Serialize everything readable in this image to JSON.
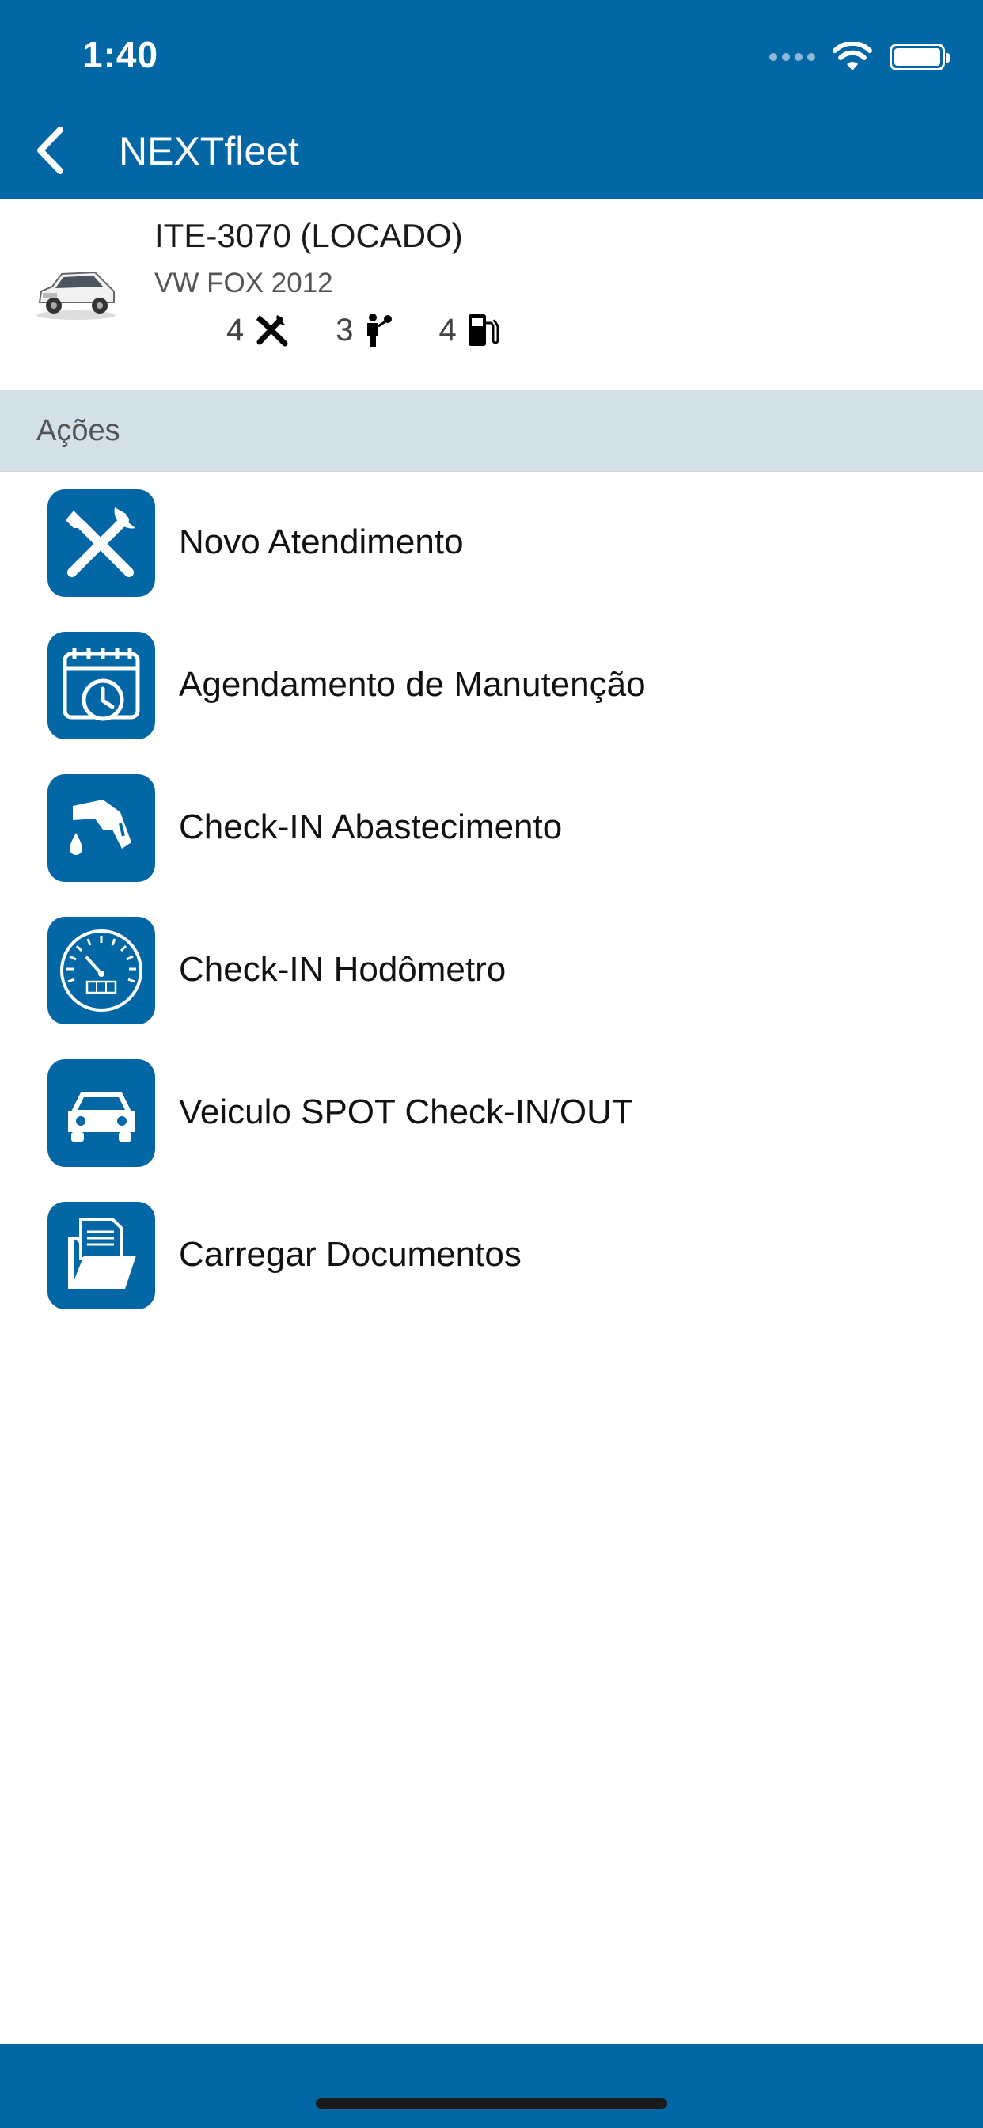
{
  "status_bar": {
    "time": "1:40"
  },
  "nav": {
    "title": "NEXTfleet"
  },
  "vehicle": {
    "plate": "ITE-3070 (LOCADO)",
    "model": "VW FOX 2012",
    "stats": [
      {
        "value": "4",
        "icon": "tools-icon"
      },
      {
        "value": "3",
        "icon": "attendant-icon"
      },
      {
        "value": "4",
        "icon": "fuel-pump-icon"
      }
    ]
  },
  "section": {
    "title": "Ações"
  },
  "actions": [
    {
      "label": "Novo Atendimento",
      "icon": "tools-icon"
    },
    {
      "label": "Agendamento de Manutenção",
      "icon": "calendar-clock-icon"
    },
    {
      "label": "Check-IN Abastecimento",
      "icon": "fuel-nozzle-icon"
    },
    {
      "label": "Check-IN Hodômetro",
      "icon": "odometer-icon"
    },
    {
      "label": "Veiculo SPOT Check-IN/OUT",
      "icon": "car-icon"
    },
    {
      "label": "Carregar Documentos",
      "icon": "documents-folder-icon"
    }
  ],
  "colors": {
    "primary": "#0366a5",
    "section_bg": "#d4e0e8",
    "background": "#ffffff"
  }
}
